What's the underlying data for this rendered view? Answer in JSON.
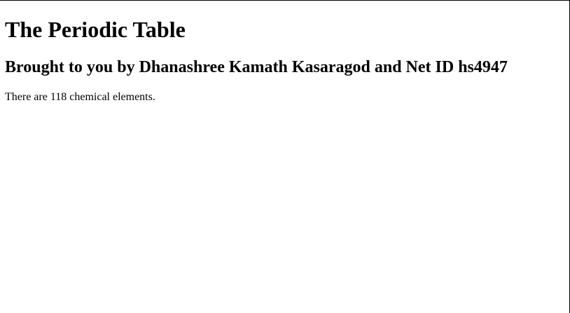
{
  "page": {
    "title": "The Periodic Table",
    "subtitle": "Brought to you by Dhanashree Kamath Kasaragod and Net ID hs4947",
    "summary": "There are 118 chemical elements."
  }
}
